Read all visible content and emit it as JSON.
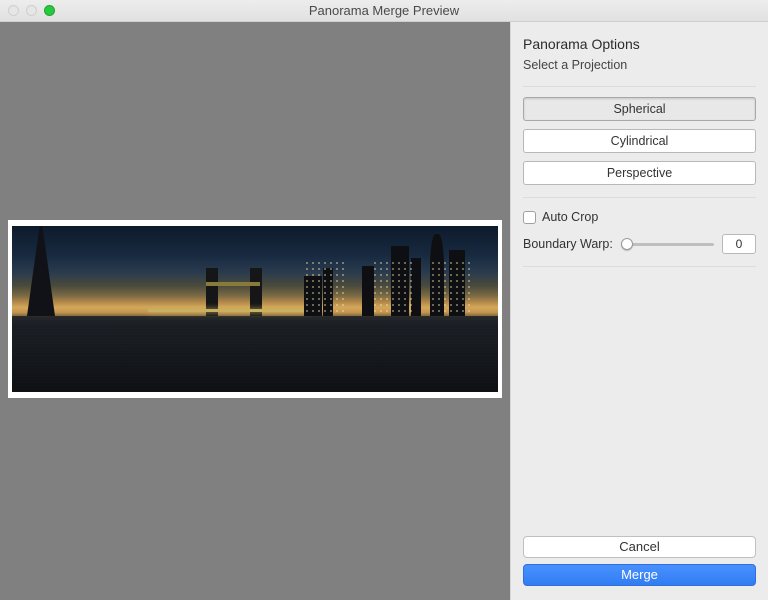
{
  "window": {
    "title": "Panorama Merge Preview"
  },
  "panel": {
    "heading": "Panorama Options",
    "subheading": "Select a Projection",
    "projections": [
      {
        "label": "Spherical",
        "selected": true
      },
      {
        "label": "Cylindrical",
        "selected": false
      },
      {
        "label": "Perspective",
        "selected": false
      }
    ],
    "auto_crop": {
      "label": "Auto Crop",
      "checked": false
    },
    "boundary_warp": {
      "label": "Boundary Warp:",
      "value": "0"
    },
    "cancel_label": "Cancel",
    "merge_label": "Merge"
  }
}
